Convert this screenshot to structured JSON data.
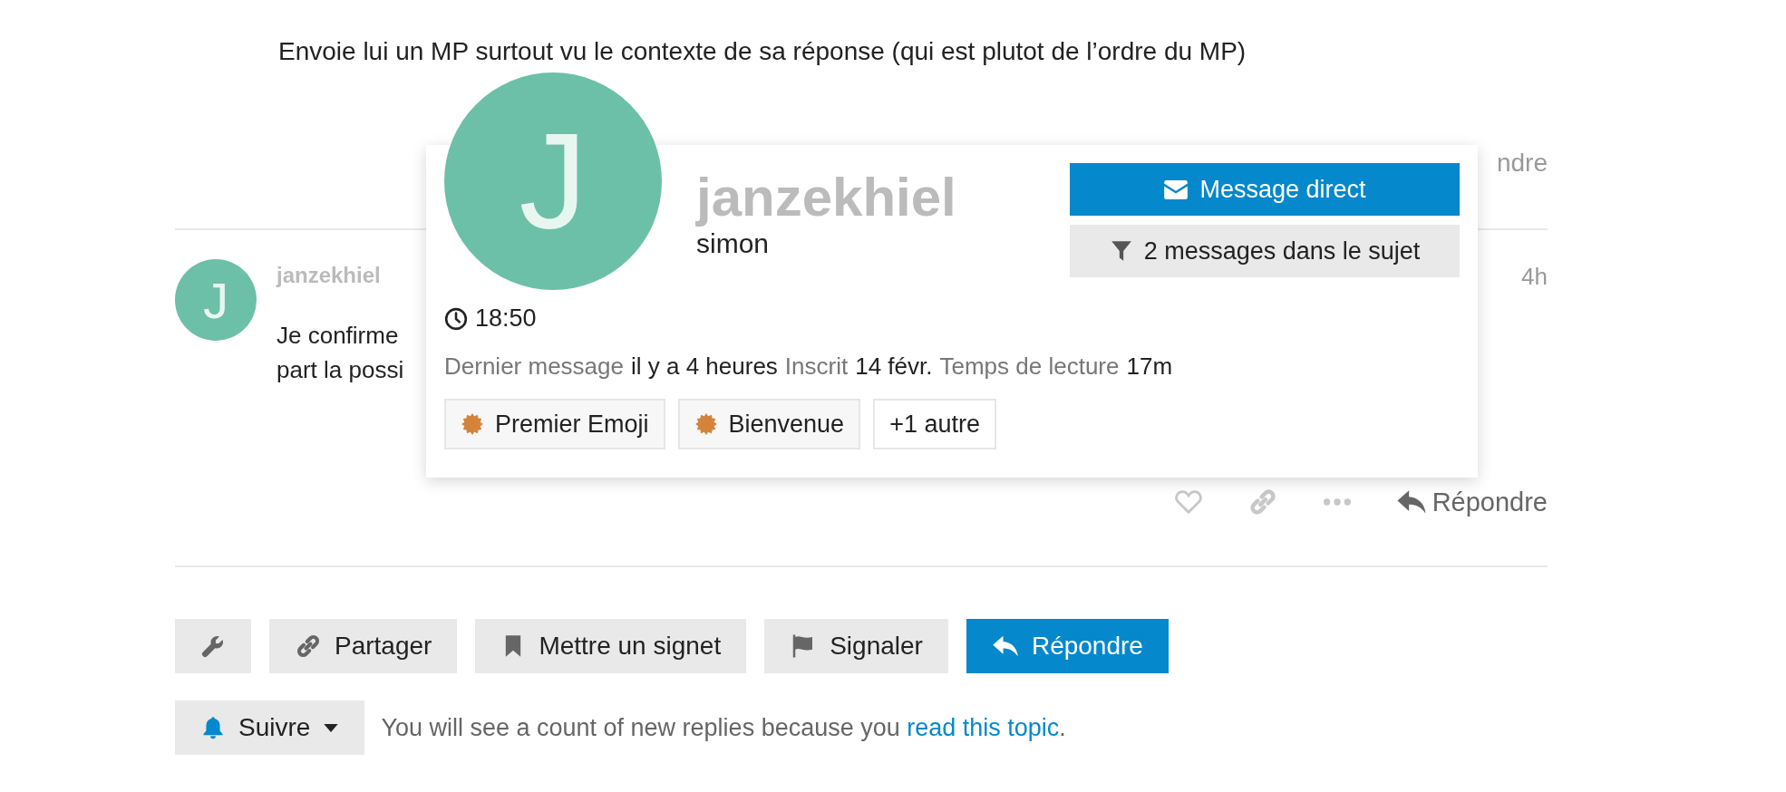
{
  "previous_post": {
    "text": "Envoie lui un MP surtout vu le contexte de sa réponse (qui est plutot de l’ordre du MP)",
    "reply_partial": "ndre"
  },
  "post": {
    "avatar_letter": "J",
    "username": "janzekhiel",
    "age": "4h",
    "body_lines": [
      "Je confirme",
      "part la possi"
    ],
    "reply": "Répondre"
  },
  "user_card": {
    "avatar_letter": "J",
    "username": "janzekhiel",
    "name": "simon",
    "buttons": [
      {
        "kind": "message",
        "label": "Message direct",
        "primary": true
      },
      {
        "kind": "filter",
        "label": "2 messages dans le sujet",
        "primary": false
      }
    ],
    "local_time": "18:50",
    "stats": [
      {
        "label": "Dernier message",
        "value": "il y a 4 heures"
      },
      {
        "label": "Inscrit",
        "value": "14 févr."
      },
      {
        "label": "Temps de lecture",
        "value": "17m"
      }
    ],
    "badges": [
      {
        "kind": "badge",
        "label": "Premier Emoji"
      },
      {
        "kind": "badge",
        "label": "Bienvenue"
      },
      {
        "kind": "more",
        "label": "+1 autre"
      }
    ]
  },
  "topic_buttons": [
    {
      "kind": "wrench",
      "primary": false
    },
    {
      "kind": "share",
      "label": "Partager",
      "primary": false
    },
    {
      "kind": "bookmark",
      "label": "Mettre un signet",
      "primary": false
    },
    {
      "kind": "flag",
      "label": "Signaler",
      "primary": false
    },
    {
      "kind": "reply",
      "label": "Répondre",
      "primary": true
    }
  ],
  "notifications": {
    "button": "Suivre",
    "text": "You will see a count of new replies because you ",
    "link": "read this topic",
    "after": "."
  }
}
